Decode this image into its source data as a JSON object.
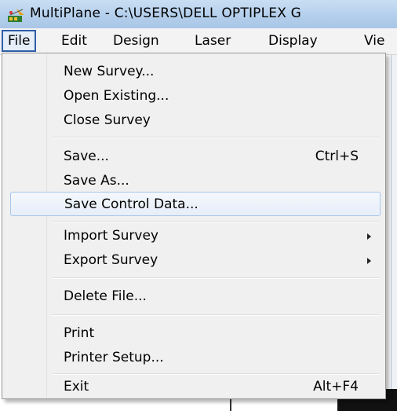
{
  "window": {
    "title": "MultiPlane - C:\\USERS\\DELL OPTIPLEX G",
    "icon": "multiplane-app-icon"
  },
  "menubar": {
    "items": [
      {
        "label": "File"
      },
      {
        "label": "Edit"
      },
      {
        "label": "Design"
      },
      {
        "label": "Laser"
      },
      {
        "label": "Display"
      },
      {
        "label": "Vie"
      }
    ],
    "active": "File"
  },
  "file_menu": {
    "items": [
      {
        "label": "New Survey...",
        "shortcut": ""
      },
      {
        "label": "Open Existing...",
        "shortcut": ""
      },
      {
        "label": "Close Survey",
        "shortcut": ""
      },
      {
        "label": "Save...",
        "shortcut": "Ctrl+S"
      },
      {
        "label": "Save As...",
        "shortcut": ""
      },
      {
        "label": "Save Control Data...",
        "shortcut": "",
        "highlighted": true
      },
      {
        "label": "Import Survey",
        "submenu": true
      },
      {
        "label": "Export Survey",
        "submenu": true
      },
      {
        "label": "Delete File...",
        "shortcut": ""
      },
      {
        "label": "Print",
        "shortcut": ""
      },
      {
        "label": "Printer Setup...",
        "shortcut": ""
      },
      {
        "label": "Exit",
        "shortcut": "Alt+F4"
      }
    ]
  },
  "colors": {
    "titlebar": "#b4cfec",
    "menu_background": "#f0f0f0",
    "highlight_border": "#a9c7e9",
    "active_menu_border": "#2e5ea8"
  }
}
